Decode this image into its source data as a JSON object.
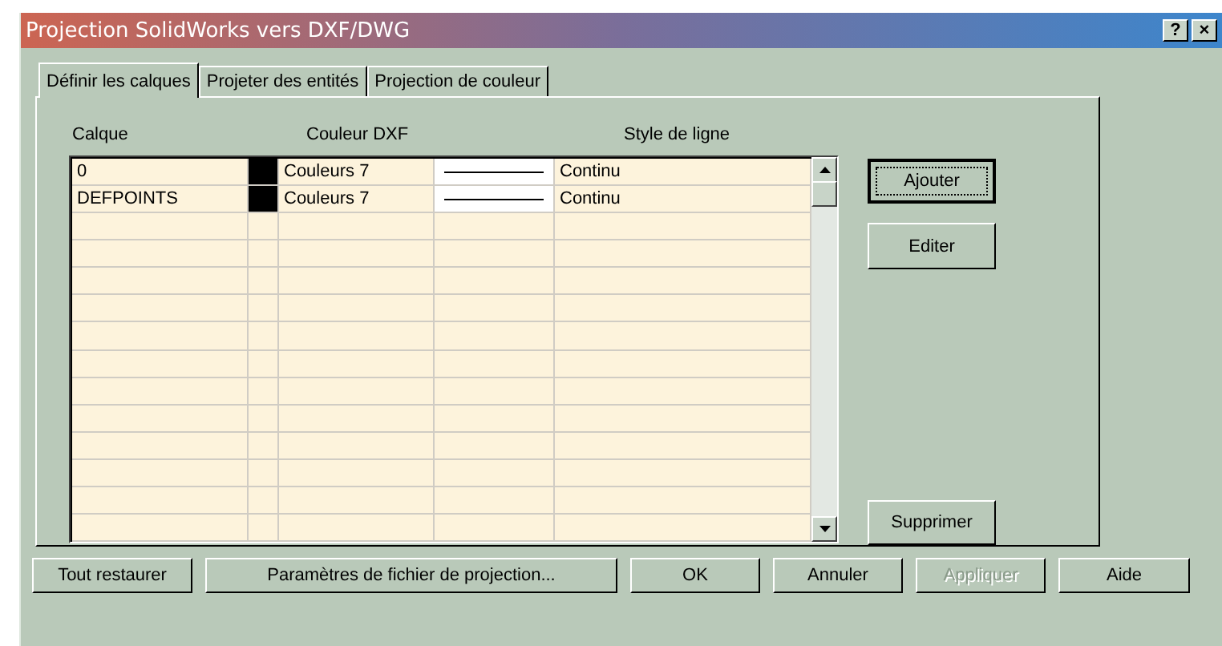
{
  "window": {
    "title": "Projection SolidWorks vers DXF/DWG",
    "title_buttons": [
      "?",
      "×"
    ]
  },
  "tabs": [
    {
      "label": "Définir les calques",
      "selected": true
    },
    {
      "label": "Projeter des entités",
      "selected": false
    },
    {
      "label": "Projection de couleur",
      "selected": false
    }
  ],
  "table": {
    "columns": [
      "Calque",
      "Couleur DXF",
      "Style de ligne"
    ],
    "rows": [
      {
        "layer": "0",
        "color": "#000000",
        "color_name": "Couleurs 7",
        "line_style": "Continu"
      },
      {
        "layer": "DEFPOINTS",
        "color": "#000000",
        "color_name": "Couleurs 7",
        "line_style": "Continu"
      }
    ]
  },
  "side_buttons": [
    {
      "label": "Ajouter",
      "focused": true
    },
    {
      "label": "Editer",
      "focused": false
    },
    {
      "label": "Supprimer",
      "focused": false
    }
  ],
  "buttons": [
    {
      "label": "Tout restaurer",
      "disabled": false
    },
    {
      "label": "Paramètres de fichier de projection...",
      "disabled": false
    },
    {
      "label": "OK",
      "disabled": false
    },
    {
      "label": "Annuler",
      "disabled": false
    },
    {
      "label": "Appliquer",
      "disabled": true
    },
    {
      "label": "Aide",
      "disabled": false
    }
  ]
}
